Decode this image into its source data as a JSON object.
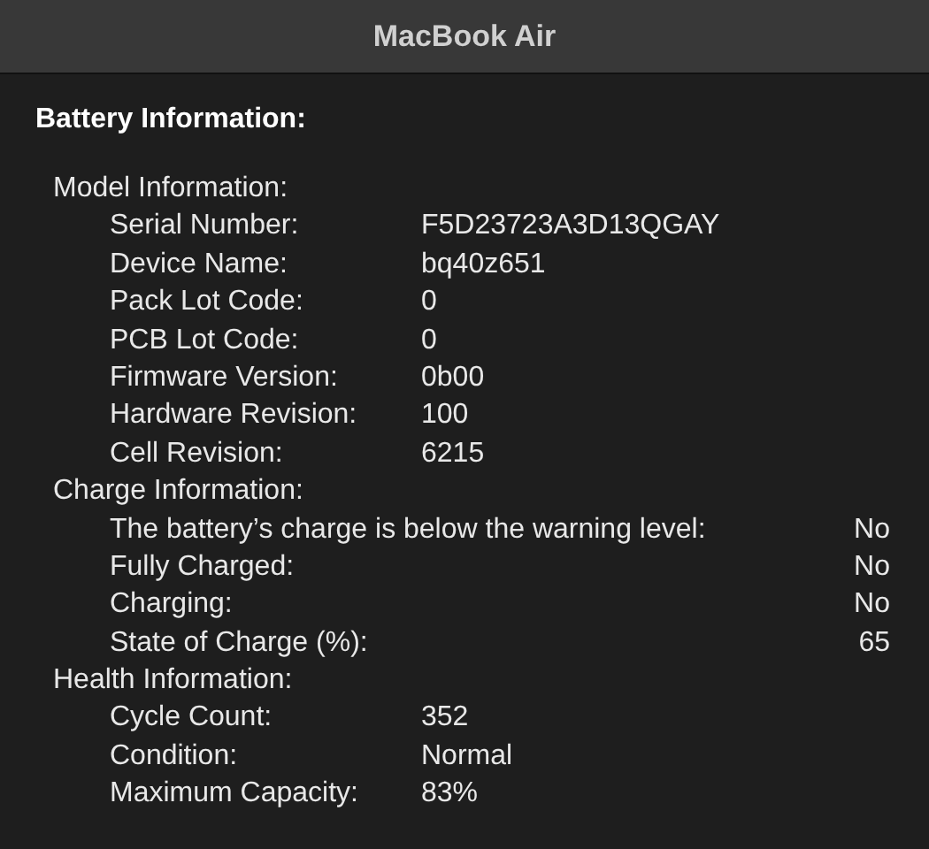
{
  "window": {
    "title": "MacBook Air"
  },
  "heading": "Battery Information:",
  "sections": [
    {
      "title": "Model Information:",
      "kind": "columns",
      "rows": [
        {
          "label": "Serial Number:",
          "value": "F5D23723A3D13QGAY"
        },
        {
          "label": "Device Name:",
          "value": "bq40z651"
        },
        {
          "label": "Pack Lot Code:",
          "value": "0"
        },
        {
          "label": "PCB Lot Code:",
          "value": "0"
        },
        {
          "label": "Firmware Version:",
          "value": "0b00"
        },
        {
          "label": "Hardware Revision:",
          "value": "100"
        },
        {
          "label": "Cell Revision:",
          "value": "6215"
        }
      ]
    },
    {
      "title": "Charge Information:",
      "kind": "right",
      "rows": [
        {
          "label": "The battery’s charge is below the warning level:",
          "value": "No"
        },
        {
          "label": "Fully Charged:",
          "value": "No"
        },
        {
          "label": "Charging:",
          "value": "No"
        },
        {
          "label": "State of Charge (%):",
          "value": "65"
        }
      ]
    },
    {
      "title": "Health Information:",
      "kind": "columns",
      "rows": [
        {
          "label": "Cycle Count:",
          "value": "352"
        },
        {
          "label": "Condition:",
          "value": "Normal"
        },
        {
          "label": "Maximum Capacity:",
          "value": "83%"
        }
      ]
    }
  ]
}
